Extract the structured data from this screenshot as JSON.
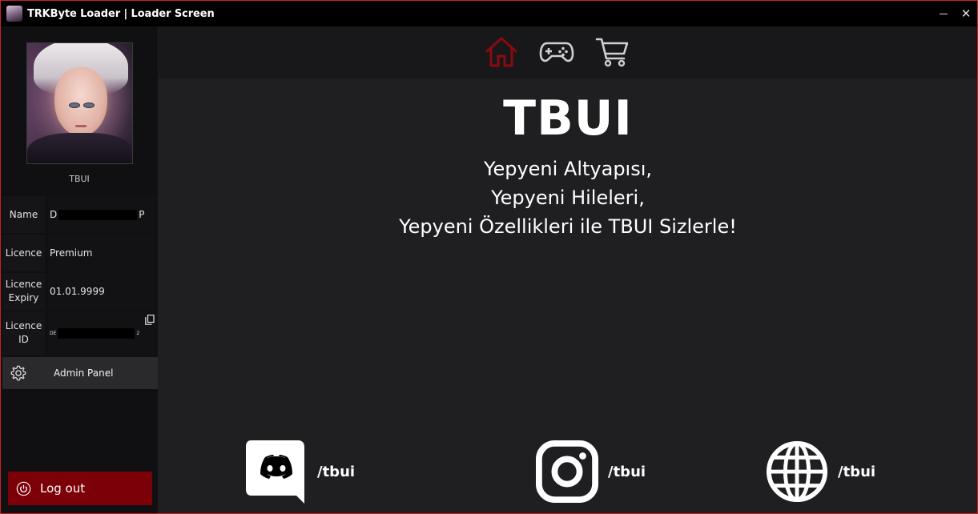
{
  "window": {
    "title": "TRKByte Loader | Loader Screen",
    "accent_color": "#c8232b",
    "minimize_icon": "minimize-icon",
    "close_icon": "close-icon",
    "close_glyph": "✕"
  },
  "sidebar": {
    "username": "TBUI",
    "fields": {
      "name_label": "Name",
      "name_value_start": "D",
      "name_value_end": "P",
      "licence_label": "Licence",
      "licence_value": "Premium",
      "expiry_label": "Licence Expiry",
      "expiry_value": "01.01.9999",
      "id_label": "Licence ID",
      "id_value_start": "DE",
      "id_value_end": "2"
    },
    "admin_panel": "Admin Panel",
    "logout": "Log out",
    "logout_color": "#7c0007"
  },
  "nav": {
    "items": [
      {
        "icon": "home-icon",
        "active": true,
        "color": "#8b0a0f"
      },
      {
        "icon": "gamepad-icon",
        "active": false,
        "color": "#cfcfcf"
      },
      {
        "icon": "cart-icon",
        "active": false,
        "color": "#cfcfcf"
      }
    ]
  },
  "main": {
    "title": "TBUI",
    "lines": [
      "Yepyeni Altyapısı,",
      "Yepyeni Hileleri,",
      "Yepyeni Özellikleri ile TBUI Sizlerle!"
    ]
  },
  "socials": [
    {
      "icon": "discord-icon",
      "handle": "/tbui"
    },
    {
      "icon": "instagram-icon",
      "handle": "/tbui"
    },
    {
      "icon": "globe-icon",
      "handle": "/tbui"
    }
  ]
}
